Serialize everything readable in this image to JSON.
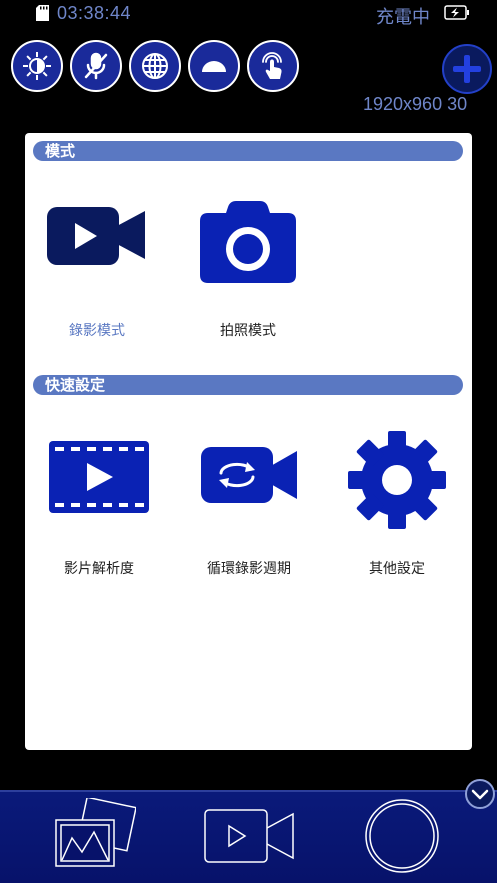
{
  "status_bar": {
    "time": "03:38:44",
    "charging": "充電中"
  },
  "top_controls": {
    "buttons": [
      {
        "icon": "brightness-icon"
      },
      {
        "icon": "mic-muted-icon"
      },
      {
        "icon": "globe-icon"
      },
      {
        "icon": "dome-light-icon"
      },
      {
        "icon": "touch-icon"
      }
    ],
    "resolution": "1920x960 30"
  },
  "panel": {
    "mode_section": {
      "title": "模式",
      "items": [
        {
          "label": "錄影模式",
          "icon": "video-camera-icon",
          "active": true
        },
        {
          "label": "拍照模式",
          "icon": "photo-camera-icon",
          "active": false
        }
      ]
    },
    "quick_settings_section": {
      "title": "快速設定",
      "items": [
        {
          "label": "影片解析度",
          "icon": "film-icon"
        },
        {
          "label": "循環錄影週期",
          "icon": "loop-record-icon"
        },
        {
          "label": "其他設定",
          "icon": "gear-icon"
        }
      ]
    }
  },
  "colors": {
    "accent": "#5a78c2",
    "button_blue": "#1a2a9a",
    "icon_navy": "#0a1a5e",
    "icon_blue": "#0a22b4",
    "status_text": "#6f86c9"
  }
}
